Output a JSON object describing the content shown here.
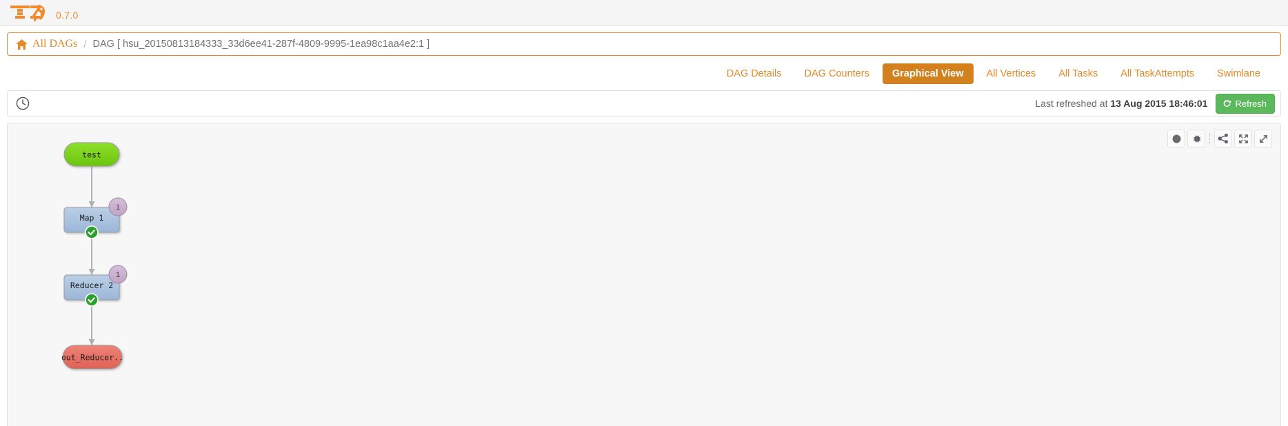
{
  "header": {
    "logo_text": "TEZ",
    "logo_icon": "tez-elephant-icon",
    "version": "0.7.0"
  },
  "breadcrumb": {
    "home_icon": "home-icon",
    "all_dags_label": "All DAGs",
    "separator": "/",
    "current": "DAG [ hsu_20150813184333_33d6ee41-287f-4809-9995-1ea98c1aa4e2:1 ]"
  },
  "tabs": [
    {
      "label": "DAG Details",
      "active": false
    },
    {
      "label": "DAG Counters",
      "active": false
    },
    {
      "label": "Graphical View",
      "active": true
    },
    {
      "label": "All Vertices",
      "active": false
    },
    {
      "label": "All Tasks",
      "active": false
    },
    {
      "label": "All TaskAttempts",
      "active": false
    },
    {
      "label": "Swimlane",
      "active": false
    }
  ],
  "refresh": {
    "clock_icon": "clock-icon",
    "prefix": "Last refreshed at",
    "timestamp": "13 Aug 2015 18:46:01",
    "button_label": "Refresh",
    "button_icon": "refresh-icon",
    "button_color": "#5cb85c"
  },
  "graph_toolbar": [
    {
      "icon": "filled-circle-icon",
      "name": "node-style-toggle"
    },
    {
      "icon": "gear-icon",
      "name": "settings"
    },
    {
      "icon": "share-nodes-icon",
      "name": "graph-layout"
    },
    {
      "icon": "expand-arrows-icon",
      "name": "fit-to-screen"
    },
    {
      "icon": "diagonal-arrow-icon",
      "name": "fullscreen"
    }
  ],
  "graph": {
    "nodes": [
      {
        "id": "test",
        "label": "test",
        "shape": "pill",
        "fill": "#7ed321",
        "badge": null,
        "status": null
      },
      {
        "id": "map1",
        "label": "Map 1",
        "shape": "box",
        "fill": "#a8c0e0",
        "badge": "1",
        "status": "succeeded"
      },
      {
        "id": "reducer2",
        "label": "Reducer 2",
        "shape": "box",
        "fill": "#a8c0e0",
        "badge": "1",
        "status": "succeeded"
      },
      {
        "id": "out_reducer",
        "label": "out_Reducer..",
        "shape": "pill",
        "fill": "#e8736a",
        "badge": null,
        "status": null
      }
    ],
    "edges": [
      {
        "from": "test",
        "to": "map1"
      },
      {
        "from": "map1",
        "to": "reducer2"
      },
      {
        "from": "reducer2",
        "to": "out_reducer"
      }
    ],
    "edge_color": "#b0b0b0",
    "badge_fill": "#c9b0cd",
    "status_color": "#2ca02c"
  }
}
